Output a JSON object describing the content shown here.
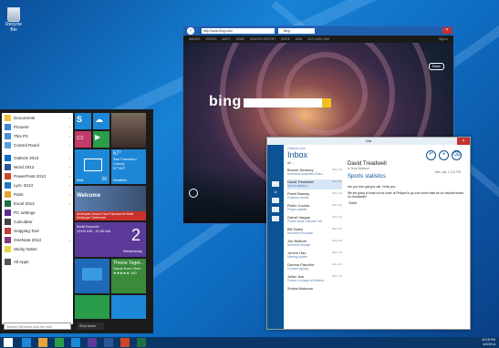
{
  "desktop": {
    "recycle_bin_label": "Recycle Bin"
  },
  "start_menu": {
    "items": [
      {
        "label": "Documents",
        "color": "#f0c040",
        "arrow": true
      },
      {
        "label": "Pictures",
        "color": "#3a86d8",
        "arrow": true
      },
      {
        "label": "This PC",
        "color": "#4a90d9",
        "arrow": true
      },
      {
        "label": "Control Panel",
        "color": "#5aa0e0",
        "arrow": true
      },
      {
        "label": "Outlook 2013",
        "color": "#0b6bc3",
        "arrow": true
      },
      {
        "label": "Word 2013",
        "color": "#2b5797",
        "arrow": true
      },
      {
        "label": "PowerPoint 2013",
        "color": "#d04525",
        "arrow": true
      },
      {
        "label": "Lync 2013",
        "color": "#1e7ac6",
        "arrow": true
      },
      {
        "label": "Paint",
        "color": "#e6a13a",
        "arrow": true
      },
      {
        "label": "Excel 2013",
        "color": "#1e7145",
        "arrow": true
      },
      {
        "label": "PC settings",
        "color": "#5b2c8e",
        "arrow": false
      },
      {
        "label": "Calculator",
        "color": "#444444",
        "arrow": false
      },
      {
        "label": "Snipping Tool",
        "color": "#c04040",
        "arrow": false
      },
      {
        "label": "OneNote 2013",
        "color": "#80397b",
        "arrow": true
      },
      {
        "label": "Sticky Notes",
        "color": "#e8d24a",
        "arrow": false
      }
    ],
    "all_apps": "All Apps",
    "search_placeholder": "Search Windows and the web",
    "shutdown_label": "Shut down"
  },
  "tiles": {
    "weather_temp": "57°",
    "weather_city": "San Francisco",
    "weather_cond": "Cloudy",
    "weather_range": "57°/49°",
    "mail_label": "Mail",
    "mail_count": "20",
    "weather_label": "Weather",
    "welcome_title": "Welcome",
    "news_text": "Developers Head to San Francisco for Build Developer Conference",
    "calendar_event": "Build Keynote",
    "calendar_time": "10:00 AM - 11:00 AM",
    "calendar_day": "Wednesday",
    "calendar_date": "2",
    "store_title": "Throne Toget...",
    "store_sub": "Game from Xbox",
    "store_price": "★★★★★ 180"
  },
  "browser": {
    "address": "http://www.bing.com/",
    "tab_title": "Bing",
    "nav": [
      "IMAGES",
      "VIDEOS",
      "MAPS",
      "NEWS",
      "SEARCH HISTORY",
      "MORE",
      "MSN",
      "OUTLOOK.COM"
    ],
    "logo": "bing",
    "share_label": "Share",
    "sign_in": "Sign in"
  },
  "mail": {
    "window_title": "Mail",
    "account": "Outlook.com",
    "folder": "Inbox",
    "filter": "All",
    "rail_count": "11",
    "messages": [
      {
        "from": "Bonnie Kearney",
        "subject": "Northwind Acquisition Deta...",
        "date": "Mon 4/1"
      },
      {
        "from": "David Treadwell",
        "subject": "Sports statistics",
        "date": "Mon 4/1",
        "selected": true
      },
      {
        "from": "Pavel Bansky",
        "subject": "Expense reports",
        "date": "Mon 4/1"
      },
      {
        "from": "Robin Counts",
        "subject": "Project update!",
        "date": "Mon 4/1"
      },
      {
        "from": "Garret Vargas",
        "subject": "Please email customer info",
        "date": "Mon 4/1"
      },
      {
        "from": "Bill Gates",
        "subject": "Northwind Proposal",
        "date": "Mon 4/1"
      },
      {
        "from": "Joe Belfiore",
        "subject": "Northwind Budget",
        "date": "Mon 4/1"
      },
      {
        "from": "Jumrin Hao",
        "subject": "Meeting update",
        "date": "Mon 4/1"
      },
      {
        "from": "Dorena Paschke",
        "subject": "Contract signing",
        "date": "Mon 4/1"
      },
      {
        "from": "Julian Isla",
        "subject": "Person in charge at Northwi...",
        "date": "Mon 4/1"
      },
      {
        "from": "Zrinka Makovac",
        "subject": "",
        "date": ""
      }
    ],
    "reading": {
      "from": "David Treadwell",
      "to": "to Terry Myerson",
      "date": "Mon, Apr 1 2:22 PM",
      "subject": "Sports statistics",
      "body1": "Are you ever going to call, I miss you...",
      "body2": "We are going to head out for lunch at Philippe to go over some stats for our favorite teams. Go Seahawks!",
      "sign": "~David"
    }
  },
  "taskbar": {
    "time": "10:18 PM",
    "date": "4/2/2014"
  }
}
